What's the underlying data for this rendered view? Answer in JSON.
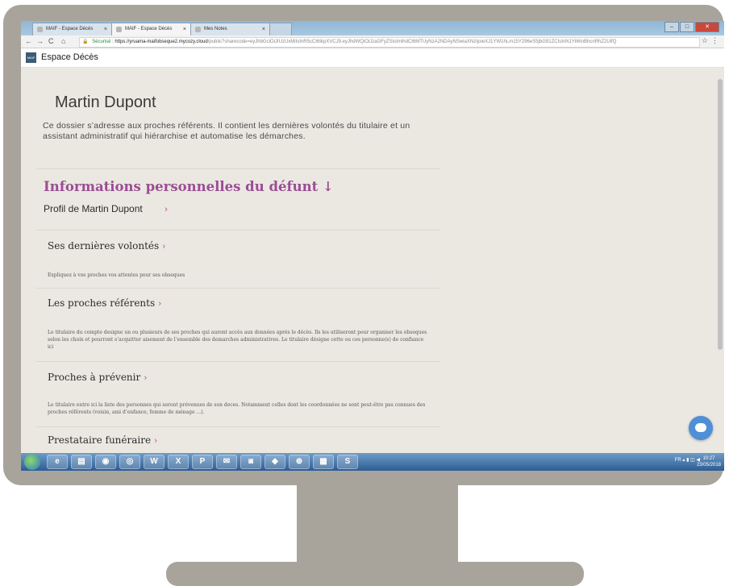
{
  "browser": {
    "tabs": [
      {
        "label": "MAIF - Espace Décès",
        "close": "×"
      },
      {
        "label": "MAIF - Espace Décès",
        "close": "×"
      },
      {
        "label": "Mes Notes",
        "close": "×"
      }
    ],
    "nav": {
      "back": "←",
      "forward": "→",
      "reload": "C",
      "home": "⌂"
    },
    "address": {
      "secure_label": "Sécurisé",
      "host": "https://yruama-maifobseque2.mycozy.cloud",
      "path": "/public?sharecode=eyJhbGciOiJIUzUxMiIsInR5cCI6IkpXVCJ9.eyJhdWQiOiJzaGFyZSIsImlhdCI6MTUyNzA2NDAyNSwiaXNzIjoieXJ1YW1hLm15Y296eS5jbG91ZCIsInN1YiI6InBhcnRhZ2UifQ"
    },
    "icons": {
      "star": "☆",
      "menu": "⋮"
    },
    "window_controls": [
      "–",
      "□",
      "✕"
    ]
  },
  "app": {
    "logo_text": "MAIF",
    "title": "Espace Décès"
  },
  "page": {
    "person_name": "Martin Dupont",
    "intro": "Ce dossier s’adresse aux proches référents. Il contient les dernières volontés du titulaire et un assistant administratif qui hiérarchise et automatise les démarches.",
    "section_title": "Informations personnelles du défunt ↓",
    "profile_link": "Profil de Martin Dupont",
    "chevron": "›",
    "items": [
      {
        "title": "Ses dernières volontés",
        "desc": "Expliquez à vos proches vos attentes pour ses obseques"
      },
      {
        "title": "Les proches référents",
        "desc": "Le titulaire du compte designe un ou plusieurs de ses proches qui auront accès aux données après le décès. Ils les utiliseront pour organiser les obseques selon les choix et pourront s’acquitter aisement de l’ensemble des demarches administratives. Le titulaire désigne cette ou ces personne(s) de confiance ici"
      },
      {
        "title": "Proches à prévenir",
        "desc": "Le titulaire entre ici la liste des personnes qui seront prévenues de son deces. Notamment celles dont les coordonnées ne sont peut-être pas connues des proches référents (voisin, ami d’enfance, femme de ménage ...)."
      },
      {
        "title": "Prestataire funéraire",
        "desc": ""
      }
    ]
  },
  "taskbar": {
    "apps": [
      "e",
      "▤",
      "◉",
      "◎",
      "W",
      "X",
      "P",
      "✉",
      "◙",
      "◆",
      "⊕",
      "▦",
      "S"
    ],
    "tray_text": "FR",
    "time": "10:27",
    "date": "23/05/2018"
  }
}
